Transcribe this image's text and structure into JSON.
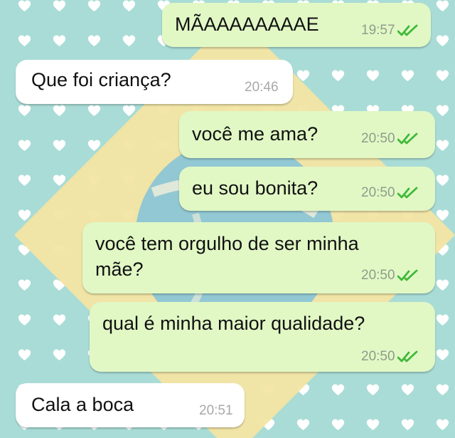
{
  "conversation": {
    "messages": [
      {
        "direction": "outgoing",
        "text": "MÃAAAAAAAAE",
        "time": "19:57",
        "status": "read"
      },
      {
        "direction": "incoming",
        "text": "Que foi criança?",
        "time": "20:46"
      },
      {
        "direction": "outgoing",
        "text": "você me ama?",
        "time": "20:50",
        "status": "read"
      },
      {
        "direction": "outgoing",
        "text": "eu sou bonita?",
        "time": "20:50",
        "status": "read"
      },
      {
        "direction": "outgoing",
        "text_lines": [
          "você tem orgulho de ser minha",
          "mãe?"
        ],
        "time": "20:50",
        "status": "read"
      },
      {
        "direction": "outgoing",
        "text": "qual é minha maior qualidade?",
        "time": "20:50",
        "status": "read"
      },
      {
        "direction": "incoming",
        "text": "Cala a boca",
        "time": "20:51"
      }
    ]
  },
  "theme": {
    "wallpaper_color": "#a9dcd6",
    "heart_color": "#ffffff",
    "diamond_color": "#f3e4a3",
    "circle_color": "#92c8d3",
    "outgoing_bubble": "#e1f8c5",
    "incoming_bubble": "#ffffff",
    "read_tick_color": "#3fb93a",
    "icons": {
      "read_receipt": "double-check-icon",
      "pattern": "heart-icon"
    }
  }
}
